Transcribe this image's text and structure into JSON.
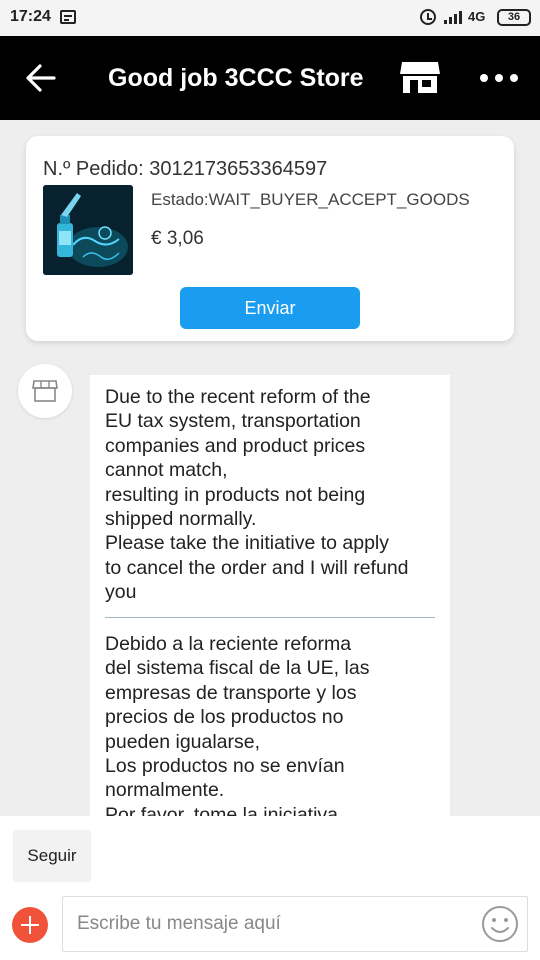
{
  "status_bar": {
    "time": "17:24",
    "network": "4G",
    "battery": "36"
  },
  "header": {
    "title": "Good job 3CCC Store"
  },
  "order": {
    "number_label": "N.º Pedido: 3012173653364597",
    "status": "Estado:WAIT_BUYER_ACCEPT_GOODS",
    "price": "€ 3,06",
    "send_label": "Enviar"
  },
  "message": {
    "english": "Due to the recent reform of the\nEU tax system, transportation\ncompanies and product prices\ncannot match,\nresulting in products not being\nshipped normally.\nPlease take the initiative to apply\nto cancel the order and I will refund\nyou",
    "spanish": "Debido a la reciente reforma\ndel sistema fiscal de la UE, las\nempresas de transporte y los\nprecios de los productos no\npueden igualarse,\nLos productos no se envían\nnormalmente.\nPor favor, tome la iniciativa"
  },
  "bottom": {
    "follow_label": "Seguir",
    "input_placeholder": "Escribe tu mensaje aquí"
  },
  "colors": {
    "header_bg": "#000000",
    "accent_blue": "#1a9df0",
    "plus_red": "#f0533a"
  },
  "icons": [
    "back-arrow-icon",
    "store-icon",
    "more-icon",
    "store-avatar-icon",
    "plus-icon",
    "emoji-icon"
  ]
}
